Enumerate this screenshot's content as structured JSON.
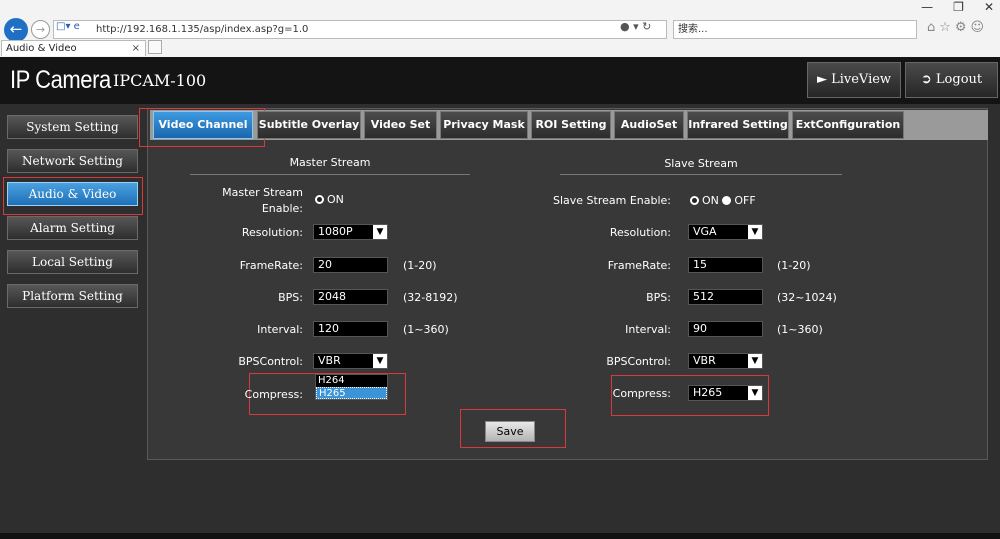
{
  "browser": {
    "window_controls": [
      "—",
      "❐",
      "✕"
    ],
    "url": "http://192.168.1.135/asp/index.asp?g=1.0",
    "search_placeholder": "搜索...",
    "tab_title": "Audio & Video"
  },
  "header": {
    "brand": "IP Camera",
    "model": "IPCAM-100",
    "liveview_label": "LiveView",
    "logout_label": "Logout"
  },
  "sidebar": {
    "items": [
      {
        "label": "System Setting"
      },
      {
        "label": "Network Setting"
      },
      {
        "label": "Audio & Video"
      },
      {
        "label": "Alarm Setting"
      },
      {
        "label": "Local Setting"
      },
      {
        "label": "Platform Setting"
      }
    ]
  },
  "tabs": [
    {
      "label": "Video Channel"
    },
    {
      "label": "Subtitle Overlay"
    },
    {
      "label": "Video Set"
    },
    {
      "label": "Privacy Mask"
    },
    {
      "label": "ROI Setting"
    },
    {
      "label": "AudioSet"
    },
    {
      "label": "Infrared Setting"
    },
    {
      "label": "ExtConfiguration"
    }
  ],
  "master": {
    "heading": "Master Stream",
    "enable_label_line1": "Master Stream",
    "enable_label_line2": "Enable:",
    "enable_on": "ON",
    "resolution_label": "Resolution:",
    "resolution_value": "1080P",
    "framerate_label": "FrameRate:",
    "framerate_value": "20",
    "framerate_range": "(1-20)",
    "bps_label": "BPS:",
    "bps_value": "2048",
    "bps_range": "(32-8192)",
    "interval_label": "Interval:",
    "interval_value": "120",
    "interval_range": "(1~360)",
    "bpscontrol_label": "BPSControl:",
    "bpscontrol_value": "VBR",
    "compress_label": "Compress:",
    "compress_options": [
      "H264",
      "H265"
    ]
  },
  "slave": {
    "heading": "Slave Stream",
    "enable_label": "Slave Stream Enable:",
    "enable_on": "ON",
    "enable_off": "OFF",
    "resolution_label": "Resolution:",
    "resolution_value": "VGA",
    "framerate_label": "FrameRate:",
    "framerate_value": "15",
    "framerate_range": "(1-20)",
    "bps_label": "BPS:",
    "bps_value": "512",
    "bps_range": "(32~1024)",
    "interval_label": "Interval:",
    "interval_value": "90",
    "interval_range": "(1~360)",
    "bpscontrol_label": "BPSControl:",
    "bpscontrol_value": "VBR",
    "compress_label": "Compress:",
    "compress_value": "H265"
  },
  "save_label": "Save",
  "colors": {
    "accent": "#1f70b6",
    "highlight_box": "#d63a3a"
  }
}
